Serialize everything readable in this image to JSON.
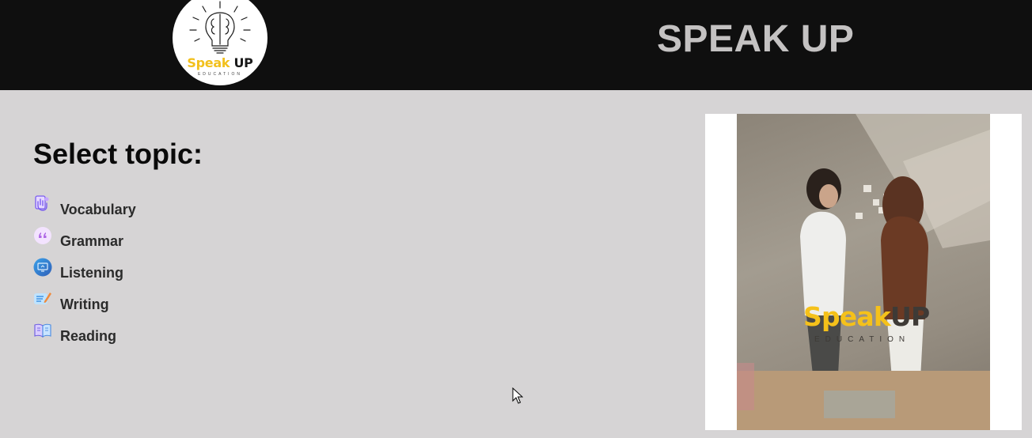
{
  "header": {
    "logo": {
      "brand_primary": "Speak",
      "brand_secondary": "UP",
      "brand_subtitle": "EDUCATION",
      "icon": "lightbulb-brain-icon"
    },
    "site_title": "SPEAK UP"
  },
  "main": {
    "title": "Select topic:",
    "topics": [
      {
        "label": "Vocabulary",
        "icon": "vocabulary-hand-icon"
      },
      {
        "label": "Grammar",
        "icon": "quote-icon"
      },
      {
        "label": "Listening",
        "icon": "monitor-icon"
      },
      {
        "label": "Writing",
        "icon": "pen-writing-icon"
      },
      {
        "label": "Reading",
        "icon": "open-book-icon"
      }
    ]
  },
  "promo": {
    "brand_primary": "Speak",
    "brand_secondary": "UP",
    "brand_subtitle": "EDUCATION"
  },
  "colors": {
    "header_bg": "#0f0f0f",
    "page_bg": "#d6d4d5",
    "brand_yellow": "#f2c01c",
    "title_gray": "#c4c2c2"
  }
}
